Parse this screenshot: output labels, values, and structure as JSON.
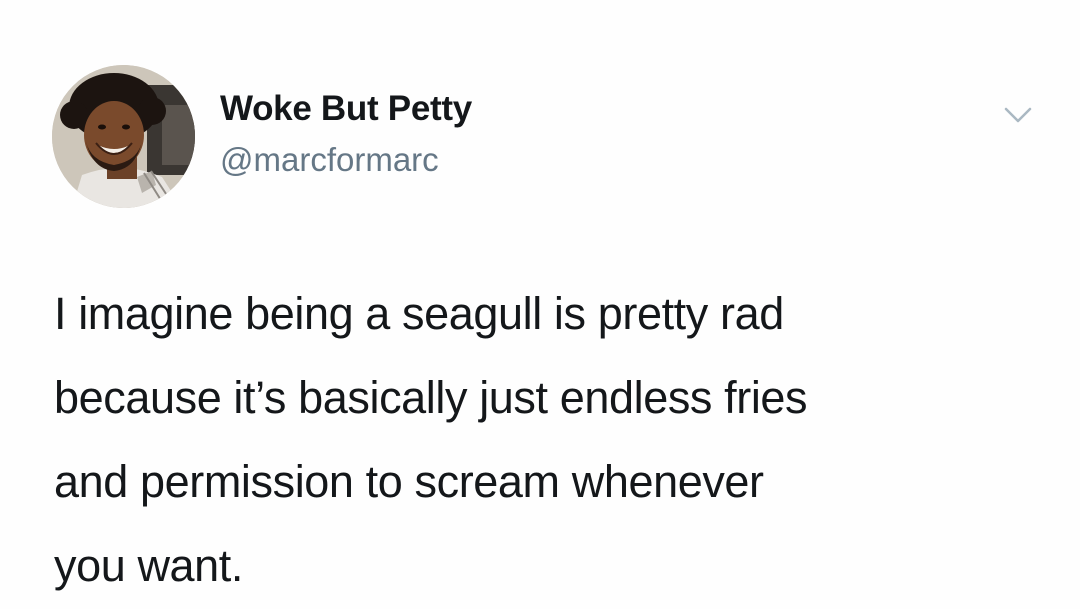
{
  "author": {
    "display_name": "Woke But Petty",
    "handle": "@marcformarc",
    "avatar_icon": "profile-photo"
  },
  "menu": {
    "icon": "chevron-down-icon"
  },
  "tweet": {
    "lines": [
      "I imagine being a seagull is pretty rad",
      "because it’s basically just endless fries",
      "and permission to scream whenever",
      "you want."
    ]
  },
  "colors": {
    "text": "#14171a",
    "secondary": "#657786",
    "background": "#fefefe"
  }
}
